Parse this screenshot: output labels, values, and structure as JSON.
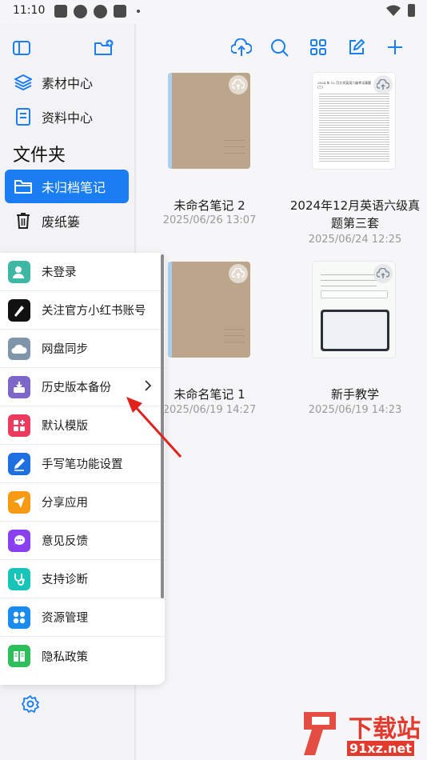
{
  "status_bar": {
    "time": "11:10"
  },
  "sidebar": {
    "items": [
      {
        "label": "素材中心",
        "icon": "layers-icon"
      },
      {
        "label": "资料中心",
        "icon": "document-icon"
      }
    ],
    "folder_section_title": "文件夹",
    "folders": [
      {
        "label": "未归档笔记",
        "icon": "folder-icon",
        "active": true
      },
      {
        "label": "废纸篓",
        "icon": "trash-icon",
        "active": false
      }
    ]
  },
  "toolbar": {
    "icons": [
      "cloud-upload-icon",
      "search-icon",
      "grid-view-icon",
      "edit-icon",
      "plus-icon"
    ]
  },
  "notes": [
    {
      "title": "未命名笔记 2",
      "date": "2025/06/26 13:07",
      "cover": "brown"
    },
    {
      "title": "2024年12月英语六级真题第三套",
      "date": "2025/06/24 12:25",
      "cover": "paper",
      "cover_heading": "2024 年 12 月大学英语六级考试真题 (三)"
    },
    {
      "title": "未命名笔记 1",
      "date": "2025/06/19 14:27",
      "cover": "brown"
    },
    {
      "title": "新手教学",
      "date": "2025/06/19 14:23",
      "cover": "tutorial"
    }
  ],
  "menu": {
    "items": [
      {
        "label": "未登录",
        "icon": "user-icon",
        "color": "#3eb8a5"
      },
      {
        "label": "关注官方小红书账号",
        "icon": "pen-nib-icon",
        "color": "#111111"
      },
      {
        "label": "网盘同步",
        "icon": "cloud-sync-icon",
        "color": "#7f95a9"
      },
      {
        "label": "历史版本备份",
        "icon": "backup-icon",
        "color": "#7d68c9",
        "has_submenu": true
      },
      {
        "label": "默认模版",
        "icon": "template-icon",
        "color": "#ee3a5f"
      },
      {
        "label": "手写笔功能设置",
        "icon": "stylus-icon",
        "color": "#1e6fe0"
      },
      {
        "label": "分享应用",
        "icon": "share-icon",
        "color": "#f59a12"
      },
      {
        "label": "意见反馈",
        "icon": "feedback-icon",
        "color": "#8a3ff0"
      },
      {
        "label": "支持诊断",
        "icon": "stethoscope-icon",
        "color": "#17c4b8"
      },
      {
        "label": "资源管理",
        "icon": "resources-icon",
        "color": "#1a8cf0"
      },
      {
        "label": "隐私政策",
        "icon": "privacy-book-icon",
        "color": "#2fbf5a"
      }
    ]
  },
  "accent_color": "#1a7ef2",
  "watermark": {
    "text_main": "下载站",
    "text_site": "91xz.net"
  }
}
